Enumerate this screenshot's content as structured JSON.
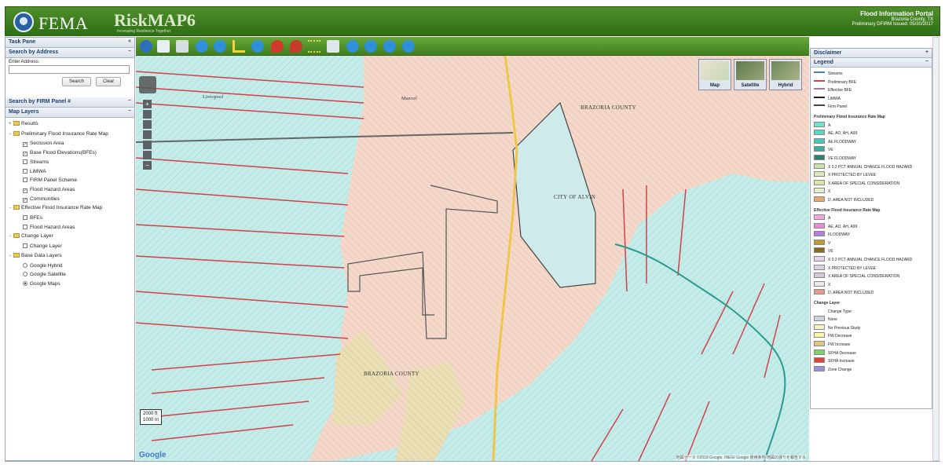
{
  "header": {
    "logo_text": "FEMA",
    "product_text": "RiskMAP6",
    "product_tagline": "Increasing Resilience Together",
    "portal_title": "Flood Information Portal",
    "portal_county": "Brazoria County, TX",
    "portal_issued": "Preliminary DFIRM Issued: 05/30/2017"
  },
  "task_pane": {
    "title": "Task Pane",
    "search_address": {
      "title": "Search by Address",
      "address_label": "Enter Address:",
      "address_value": "",
      "search_label": "Search",
      "clear_label": "Clear"
    },
    "search_firm": {
      "title": "Search by FIRM Panel #"
    },
    "map_layers": {
      "title": "Map Layers",
      "groups": [
        {
          "label": "Results",
          "items": []
        },
        {
          "label": "Preliminary Flood Insurance Rate Map",
          "items": [
            {
              "label": "Seclusion Area",
              "checked": true
            },
            {
              "label": "Base Flood Elevations(BFEs)",
              "checked": true
            },
            {
              "label": "Streams",
              "checked": false
            },
            {
              "label": "LiMWA",
              "checked": false
            },
            {
              "label": "FIRM Panel Scheme",
              "checked": false
            },
            {
              "label": "Flood Hazard Areas",
              "checked": true
            },
            {
              "label": "Communities",
              "checked": true
            }
          ]
        },
        {
          "label": "Effective Flood Insurance Rate Map",
          "items": [
            {
              "label": "BFEs",
              "checked": false
            },
            {
              "label": "Flood Hazard Areas",
              "checked": false
            }
          ]
        },
        {
          "label": "Change Layer",
          "items": [
            {
              "label": "Change Layer",
              "checked": false
            }
          ]
        },
        {
          "label": "Base Data Layers",
          "radios": [
            {
              "label": "Google Hybrid",
              "selected": false
            },
            {
              "label": "Google Satellite",
              "selected": false
            },
            {
              "label": "Google Maps",
              "selected": true
            }
          ]
        }
      ]
    }
  },
  "map": {
    "map_types": [
      "Map",
      "Satellite",
      "Hybrid"
    ],
    "labels": {
      "county_top": "BRAZORIA COUNTY",
      "city": "CITY OF ALVIN",
      "county_bottom": "BRAZORIA COUNTY",
      "town_a": "Liverpool",
      "town_b": "Manvel"
    },
    "scale": {
      "top": "2000 ft",
      "bottom": "1000 m"
    },
    "google": "Google",
    "attribution": "地図データ ©2018 Google, INEGI Google   使用条件  地図の誤りを報告する"
  },
  "right_pane": {
    "disclaimer": "Disclaimer",
    "legend_title": "Legend",
    "legend_lines": [
      {
        "label": "Streams",
        "color": "#4a7fc1"
      },
      {
        "label": "Preliminary BFE",
        "color": "#d1424a"
      },
      {
        "label": "Effective BFE",
        "color": "#a27aa0"
      },
      {
        "label": "LiMWA",
        "color": "#222222"
      },
      {
        "label": "Firm Panel",
        "color": "#444444"
      }
    ],
    "prelim_title": "Preliminary Flood Insurance Rate Map",
    "prelim_items": [
      {
        "label": "A",
        "color": "#6fe3d0"
      },
      {
        "label": "AE, AO, AH, A99",
        "color": "#5ad6c6"
      },
      {
        "label": "AE FLOODWAY",
        "color": "#49c7bd"
      },
      {
        "label": "VE",
        "color": "#3ab0a4"
      },
      {
        "label": "VE FLOODWAY",
        "color": "#2b7f73"
      },
      {
        "label": "X 0.2 PCT ANNUAL CHANCE FLOOD HAZARD",
        "color": "#c7e2a8"
      },
      {
        "label": "X PROTECTED BY LEVEE",
        "color": "#d9e8b8"
      },
      {
        "label": "X AREA OF SPECIAL CONSIDERATION",
        "color": "#dfe5a6"
      },
      {
        "label": "X",
        "color": "#e6f0c8"
      },
      {
        "label": "D, AREA NOT INCLUDED",
        "color": "#e8a86b"
      }
    ],
    "eff_title": "Effective Flood Insurance Rate Map",
    "eff_items": [
      {
        "label": "A",
        "color": "#f3a6dd"
      },
      {
        "label": "AE, AO, AH, A99",
        "color": "#e78cd4"
      },
      {
        "label": "FLOODWAY",
        "color": "#b57de0"
      },
      {
        "label": "V",
        "color": "#c29a2e"
      },
      {
        "label": "VE",
        "color": "#8a6a18"
      },
      {
        "label": "X 0.2 PCT ANNUAL CHANCE FLOOD HAZARD",
        "color": "#e8d2ec"
      },
      {
        "label": "X PROTECTED BY LEVEE",
        "color": "#ddd0e3"
      },
      {
        "label": "X AREA OF SPECIAL CONSIDERATION",
        "color": "#d8c7dc"
      },
      {
        "label": "X",
        "color": "#f1e4f0"
      },
      {
        "label": "D, AREA NOT INCLUDED",
        "color": "#e79a8c"
      }
    ],
    "change_title": "Change Layer",
    "change_type": "Change Type:",
    "change_items": [
      {
        "label": "None",
        "color": "#cdd3db"
      },
      {
        "label": "No Previous Study",
        "color": "#f4f1c4"
      },
      {
        "label": "FW Decrease",
        "color": "#fff6a8"
      },
      {
        "label": "FW Increase",
        "color": "#e3c47a"
      },
      {
        "label": "SFHA Decrease",
        "color": "#7fd36b"
      },
      {
        "label": "SFHA Increase",
        "color": "#e0453b"
      },
      {
        "label": "Zone Change",
        "color": "#9b8fd6"
      }
    ]
  },
  "colors": {
    "header_green": "#3f7f1e",
    "zone_teal": "#bfe9e6",
    "zone_peach": "#f3d3c4",
    "bfe_red": "#d1424a"
  }
}
